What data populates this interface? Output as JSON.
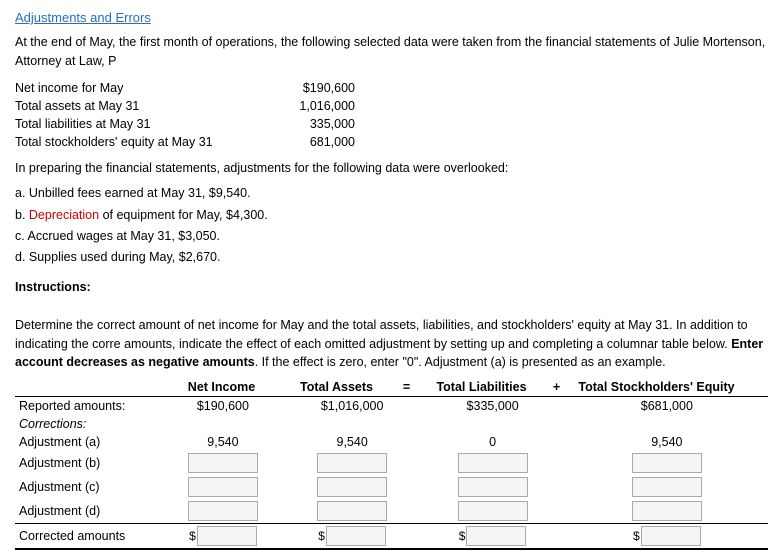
{
  "page": {
    "title": "Adjustments and Errors",
    "intro": "At the end of May, the first month of operations, the following selected data were taken from the financial statements of Julie Mortenson, Attorney at Law, P",
    "financial_items": [
      {
        "label": "Net income for May",
        "value": "$190,600"
      },
      {
        "label": "Total assets at May 31",
        "value": "1,016,000"
      },
      {
        "label": "Total liabilities at May 31",
        "value": "335,000"
      },
      {
        "label": "Total stockholders' equity at May 31",
        "value": "681,000"
      }
    ],
    "adjustments_intro": "In preparing the financial statements, adjustments for the following data were overlooked:",
    "adjustment_items": [
      {
        "id": "a",
        "text": "a. Unbilled fees earned at May 31, $9,540."
      },
      {
        "id": "b",
        "text_before": "b. ",
        "highlight": "Depreciation",
        "text_after": " of equipment for May, $4,300."
      },
      {
        "id": "c",
        "text": "c. Accrued wages at May 31, $3,050."
      },
      {
        "id": "d",
        "text": "d. Supplies used during May, $2,670."
      }
    ],
    "instructions_label": "Instructions:",
    "instructions_text": "Determine the correct amount of net income for May and the total assets, liabilities, and stockholders' equity at May 31. In addition to indicating the corre amounts, indicate the effect of each omitted adjustment by setting up and completing a columnar table below.",
    "instructions_bold": "Enter account decreases as negative amounts",
    "instructions_end": ". If the effect is zero, enter \"0\". Adjustment (a) is presented as an example.",
    "table": {
      "headers": {
        "net_income": "Net Income",
        "total_assets": "Total Assets",
        "equals": "=",
        "total_liabilities": "Total Liabilities",
        "plus": "+",
        "stockholders_equity": "Total Stockholders' Equity"
      },
      "rows": [
        {
          "label": "Reported amounts:",
          "net_income": "$190,600",
          "total_assets": "$1,016,000",
          "total_liabilities": "$335,000",
          "stockholders_equity": "$681,000",
          "type": "reported"
        },
        {
          "label": "Corrections:",
          "type": "corrections_header"
        },
        {
          "label": "Adjustment (a)",
          "net_income": "9,540",
          "total_assets": "9,540",
          "total_liabilities": "0",
          "stockholders_equity": "9,540",
          "type": "prefilled"
        },
        {
          "label": "Adjustment (b)",
          "type": "input"
        },
        {
          "label": "Adjustment (c)",
          "type": "input"
        },
        {
          "label": "Adjustment (d)",
          "type": "input"
        },
        {
          "label": "Corrected amounts",
          "type": "corrected"
        }
      ]
    }
  }
}
